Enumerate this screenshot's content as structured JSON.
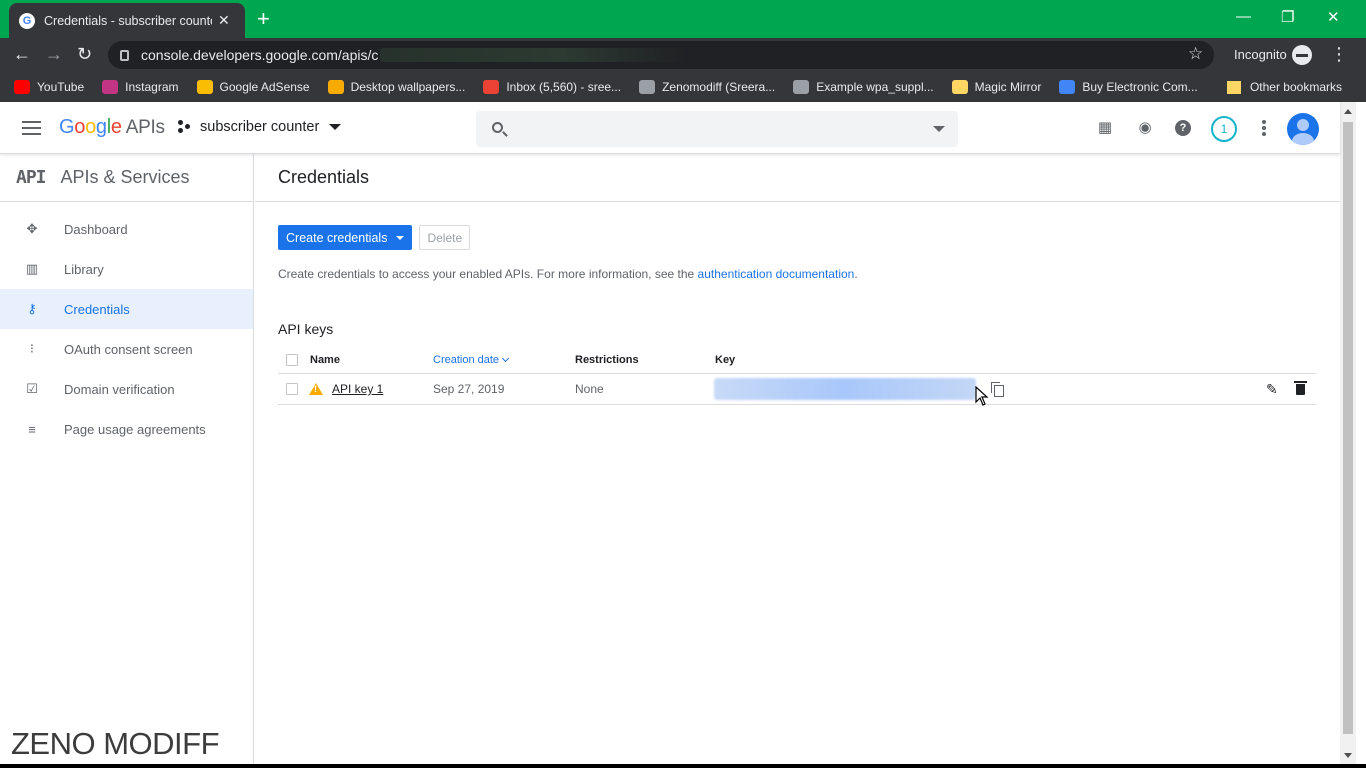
{
  "browser": {
    "tab_title": "Credentials - subscriber counter",
    "tab_close": "✕",
    "new_tab": "+",
    "window_controls": [
      "—",
      "❐",
      "✕"
    ],
    "url": "console.developers.google.com/apis/c",
    "incognito_label": "Incognito",
    "bookmarks": [
      {
        "label": "YouTube",
        "color": "#ff0000"
      },
      {
        "label": "Instagram",
        "color": "#c13584"
      },
      {
        "label": "Google AdSense",
        "color": "#fbbc04"
      },
      {
        "label": "Desktop wallpapers...",
        "color": "#f9ab00"
      },
      {
        "label": "Inbox (5,560) - sree...",
        "color": "#ea4335"
      },
      {
        "label": "Zenomodiff (Sreera...",
        "color": "#9aa0a6"
      },
      {
        "label": "Example wpa_suppl...",
        "color": "#9aa0a6"
      },
      {
        "label": "Magic Mirror",
        "color": "#fdd663"
      },
      {
        "label": "Buy Electronic Com...",
        "color": "#4285f4"
      }
    ],
    "other_bookmarks": "Other bookmarks"
  },
  "header": {
    "logo_google": "Google",
    "logo_apis": "APIs",
    "project_name": "subscriber counter",
    "notifications_count": "1"
  },
  "sidebar": {
    "api_badge": "API",
    "title": "APIs & Services",
    "items": [
      {
        "label": "Dashboard",
        "icon": "dashboard-icon",
        "glyph": "✥",
        "active": false
      },
      {
        "label": "Library",
        "icon": "library-icon",
        "glyph": "▥",
        "active": false
      },
      {
        "label": "Credentials",
        "icon": "key-icon",
        "glyph": "⚷",
        "active": true
      },
      {
        "label": "OAuth consent screen",
        "icon": "consent-icon",
        "glyph": "⁝",
        "active": false
      },
      {
        "label": "Domain verification",
        "icon": "domain-check-icon",
        "glyph": "☑",
        "active": false
      },
      {
        "label": "Page usage agreements",
        "icon": "settings-list-icon",
        "glyph": "≡",
        "active": false
      }
    ]
  },
  "main": {
    "title": "Credentials",
    "create_button": "Create credentials",
    "delete_button": "Delete",
    "info_text": "Create credentials to access your enabled APIs. For more information, see the ",
    "info_link": "authentication documentation",
    "info_end": ".",
    "section_title": "API keys",
    "table": {
      "headers": {
        "name": "Name",
        "creation_date": "Creation date",
        "restrictions": "Restrictions",
        "key": "Key"
      },
      "rows": [
        {
          "name": "API key 1",
          "creation_date": "Sep 27, 2019",
          "restrictions": "None",
          "status": "warning"
        }
      ]
    }
  },
  "watermark": "ZENO MODIFF",
  "colors": {
    "accent": "#1a73e8",
    "tabbar": "#00a650",
    "chrome_dark": "#35363a",
    "active_nav_bg": "#e8f0fe",
    "warning": "#f9ab00"
  }
}
